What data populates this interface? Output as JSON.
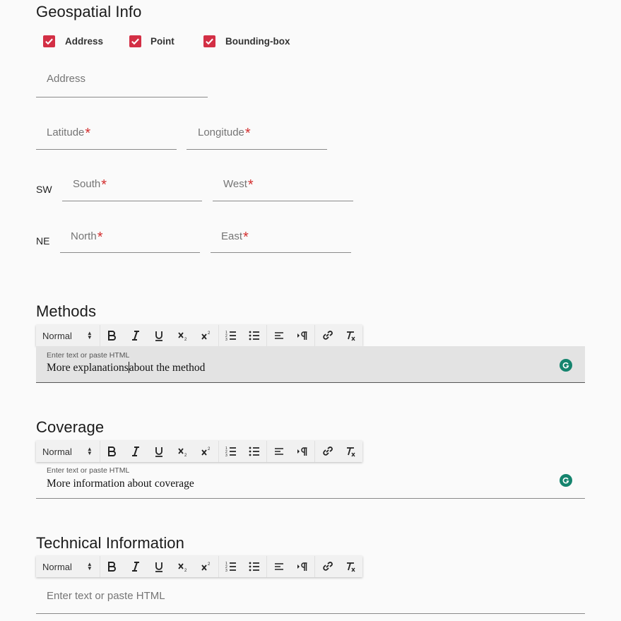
{
  "geospatial": {
    "title": "Geospatial Info",
    "checkboxes": [
      {
        "label": "Address",
        "checked": true
      },
      {
        "label": "Point",
        "checked": true
      },
      {
        "label": "Bounding-box",
        "checked": true
      }
    ],
    "address_placeholder": "Address",
    "latitude_placeholder": "Latitude",
    "longitude_placeholder": "Longitude",
    "required_mark": "*",
    "sw_label": "SW",
    "south_placeholder": "South",
    "west_placeholder": "West",
    "ne_label": "NE",
    "north_placeholder": "North",
    "east_placeholder": "East"
  },
  "toolbar": {
    "format_select": "Normal",
    "buttons": [
      "bold-icon",
      "italic-icon",
      "underline-icon",
      "subscript-icon",
      "superscript-icon",
      "ordered-list-icon",
      "bullet-list-icon",
      "align-icon",
      "text-direction-icon",
      "link-icon",
      "clear-format-icon"
    ]
  },
  "methods": {
    "title": "Methods",
    "hint": "Enter text or paste HTML",
    "content_before_caret": "More explanations",
    "content_after_caret": "about the method"
  },
  "coverage": {
    "title": "Coverage",
    "hint": "Enter text or paste HTML",
    "content": "More information about coverage"
  },
  "technical": {
    "title": "Technical Information",
    "placeholder": "Enter text or paste HTML"
  },
  "colors": {
    "accent_red": "#d32f45",
    "grammarly_green": "#15846e",
    "active_editor_bg": "#e3e3e3"
  }
}
